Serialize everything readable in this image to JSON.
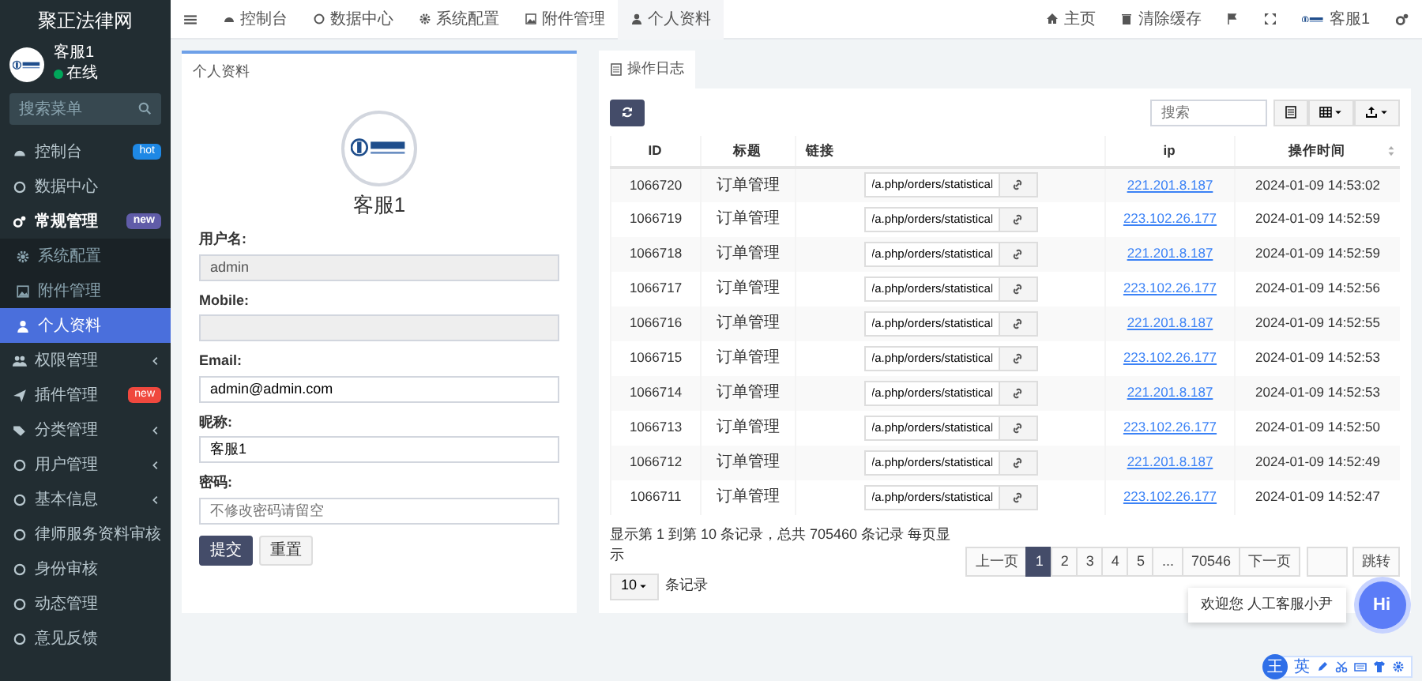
{
  "sidebar": {
    "brand": "聚正法律网",
    "user": {
      "name": "客服1",
      "status": "在线",
      "online": true
    },
    "search": {
      "placeholder": "搜索菜单"
    },
    "items": [
      {
        "label": "控制台",
        "badge": {
          "text": "hot",
          "color": "#1e88e5"
        }
      },
      {
        "label": "数据中心"
      },
      {
        "label": "常规管理",
        "badge": {
          "text": "new",
          "color": "#605ca8"
        },
        "expanded": true,
        "children": [
          {
            "label": "系统配置",
            "selected": false
          },
          {
            "label": "附件管理",
            "selected": false
          },
          {
            "label": "个人资料",
            "selected": true
          }
        ]
      },
      {
        "label": "权限管理",
        "expanded": false
      },
      {
        "label": "插件管理",
        "badge": {
          "text": "new",
          "color": "#f0483e"
        }
      },
      {
        "label": "分类管理",
        "expanded": false
      },
      {
        "label": "用户管理",
        "expanded": false
      },
      {
        "label": "基本信息",
        "expanded": false
      },
      {
        "label": "律师服务资料审核"
      },
      {
        "label": "身份审核"
      },
      {
        "label": "动态管理"
      },
      {
        "label": "意见反馈"
      }
    ]
  },
  "topbar": {
    "tabs": [
      {
        "label": "控制台",
        "selected": false
      },
      {
        "label": "数据中心",
        "selected": false
      },
      {
        "label": "系统配置",
        "selected": false
      },
      {
        "label": "附件管理",
        "selected": false
      },
      {
        "label": "个人资料",
        "selected": true
      }
    ],
    "links": [
      "主页",
      "清除缓存"
    ],
    "user": "客服1"
  },
  "profile": {
    "tab": "个人资料",
    "name": "客服1",
    "fields": [
      {
        "label": "用户名:",
        "value": "admin",
        "disabled": true
      },
      {
        "label": "Mobile:",
        "disabled": true
      },
      {
        "label": "Email:",
        "value": "admin@admin.com",
        "disabled": false
      },
      {
        "label": "昵称:",
        "value": "客服1",
        "disabled": false
      },
      {
        "label": "密码:",
        "placeholder": "不修改密码请留空",
        "disabled": false
      }
    ],
    "buttons": [
      {
        "label": "提交",
        "kind": "primary"
      },
      {
        "label": "重置",
        "kind": "default"
      }
    ]
  },
  "log": {
    "tab": "操作日志",
    "search": {
      "placeholder": "搜索"
    },
    "columns": [
      "ID",
      "标题",
      "链接",
      "ip",
      "操作时间"
    ],
    "rows": [
      {
        "id": "1066720",
        "title": "订单管理",
        "url": "/a.php/orders/statistical",
        "ip": "221.201.8.187",
        "time": "2024-01-09 14:53:02"
      },
      {
        "id": "1066719",
        "title": "订单管理",
        "url": "/a.php/orders/statistical",
        "ip": "223.102.26.177",
        "time": "2024-01-09 14:52:59"
      },
      {
        "id": "1066718",
        "title": "订单管理",
        "url": "/a.php/orders/statistical",
        "ip": "221.201.8.187",
        "time": "2024-01-09 14:52:59"
      },
      {
        "id": "1066717",
        "title": "订单管理",
        "url": "/a.php/orders/statistical",
        "ip": "223.102.26.177",
        "time": "2024-01-09 14:52:56"
      },
      {
        "id": "1066716",
        "title": "订单管理",
        "url": "/a.php/orders/statistical",
        "ip": "221.201.8.187",
        "time": "2024-01-09 14:52:55"
      },
      {
        "id": "1066715",
        "title": "订单管理",
        "url": "/a.php/orders/statistical",
        "ip": "223.102.26.177",
        "time": "2024-01-09 14:52:53"
      },
      {
        "id": "1066714",
        "title": "订单管理",
        "url": "/a.php/orders/statistical",
        "ip": "221.201.8.187",
        "time": "2024-01-09 14:52:53"
      },
      {
        "id": "1066713",
        "title": "订单管理",
        "url": "/a.php/orders/statistical",
        "ip": "223.102.26.177",
        "time": "2024-01-09 14:52:50"
      },
      {
        "id": "1066712",
        "title": "订单管理",
        "url": "/a.php/orders/statistical",
        "ip": "221.201.8.187",
        "time": "2024-01-09 14:52:49"
      },
      {
        "id": "1066711",
        "title": "订单管理",
        "url": "/a.php/orders/statistical",
        "ip": "223.102.26.177",
        "time": "2024-01-09 14:52:47"
      }
    ],
    "summary": "显示第 1 到第 10 条记录，总共 705460 条记录 每页显示",
    "page_size": "10",
    "summary_suffix": "条记录",
    "pages": [
      {
        "label": "上一页",
        "selected": false
      },
      {
        "label": "1",
        "selected": true
      },
      {
        "label": "2",
        "selected": false
      },
      {
        "label": "3",
        "selected": false
      },
      {
        "label": "4",
        "selected": false
      },
      {
        "label": "5",
        "selected": false
      },
      {
        "label": "...",
        "selected": false
      },
      {
        "label": "70546",
        "selected": false
      },
      {
        "label": "下一页",
        "selected": false
      }
    ],
    "jump": "跳转"
  },
  "chat": {
    "greeting": "欢迎您 人工客服小尹",
    "button": "Hi"
  },
  "ime": {
    "logo": "王",
    "mode": "英"
  }
}
